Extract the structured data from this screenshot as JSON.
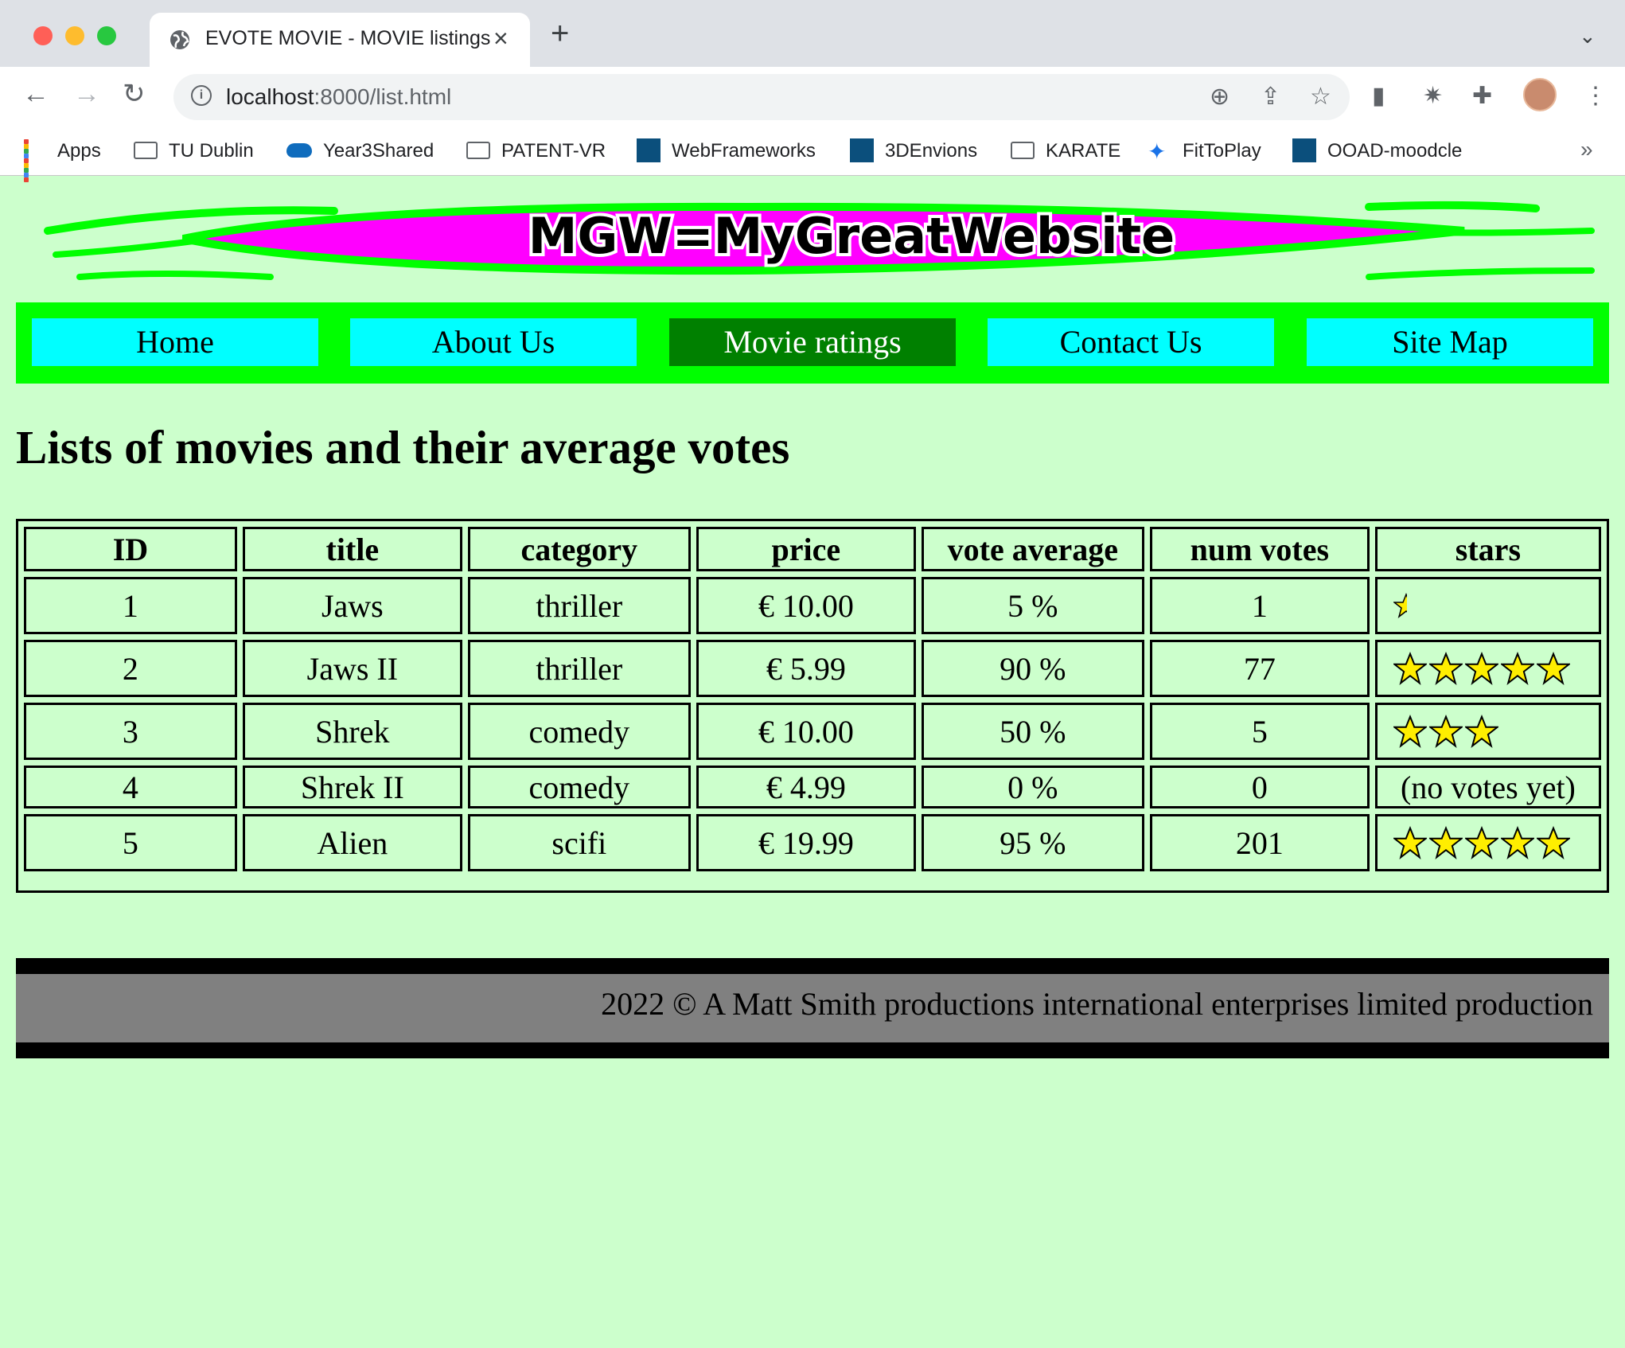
{
  "browser": {
    "tab_title": "EVOTE MOVIE - MOVIE listings",
    "url_host": "localhost",
    "url_rest": ":8000/list.html",
    "bookmarks": [
      {
        "label": "Apps",
        "icon": "apps-grid-icon"
      },
      {
        "label": "TU Dublin",
        "icon": "folder-icon"
      },
      {
        "label": "Year3Shared",
        "icon": "onedrive-cloud-icon"
      },
      {
        "label": "PATENT-VR",
        "icon": "folder-icon"
      },
      {
        "label": "WebFrameworks",
        "icon": "site-icon"
      },
      {
        "label": "3DEnvions",
        "icon": "site-icon"
      },
      {
        "label": "KARATE",
        "icon": "folder-icon"
      },
      {
        "label": "FitToPlay",
        "icon": "runner-icon"
      },
      {
        "label": "OOAD-moodcle",
        "icon": "site-icon"
      }
    ]
  },
  "banner": {
    "logo_text": "MGW=MyGreatWebsite"
  },
  "nav": [
    {
      "label": "Home",
      "active": false
    },
    {
      "label": "About Us",
      "active": false
    },
    {
      "label": "Movie ratings",
      "active": true
    },
    {
      "label": "Contact Us",
      "active": false
    },
    {
      "label": "Site Map",
      "active": false
    }
  ],
  "page": {
    "heading": "Lists of movies and their average votes"
  },
  "table": {
    "headers": [
      "ID",
      "title",
      "category",
      "price",
      "vote average",
      "num votes",
      "stars"
    ],
    "rows": [
      {
        "id": "1",
        "title": "Jaws",
        "category": "thriller",
        "price": "€ 10.00",
        "vote_average": "5 %",
        "num_votes": "1",
        "stars": 0.5,
        "stars_text": ""
      },
      {
        "id": "2",
        "title": "Jaws II",
        "category": "thriller",
        "price": "€ 5.99",
        "vote_average": "90 %",
        "num_votes": "77",
        "stars": 5,
        "stars_text": ""
      },
      {
        "id": "3",
        "title": "Shrek",
        "category": "comedy",
        "price": "€ 10.00",
        "vote_average": "50 %",
        "num_votes": "5",
        "stars": 3,
        "stars_text": ""
      },
      {
        "id": "4",
        "title": "Shrek II",
        "category": "comedy",
        "price": "€ 4.99",
        "vote_average": "0 %",
        "num_votes": "0",
        "stars": 0,
        "stars_text": "(no votes yet)"
      },
      {
        "id": "5",
        "title": "Alien",
        "category": "scifi",
        "price": "€ 19.99",
        "vote_average": "95 %",
        "num_votes": "201",
        "stars": 5,
        "stars_text": ""
      }
    ]
  },
  "footer": {
    "text": "2022 © A Matt Smith productions international enterprises limited production"
  },
  "colors": {
    "page_bg": "#ccffcc",
    "nav_bg": "#00ff00",
    "nav_item": "#00ffff",
    "nav_active": "#008000",
    "footer_bg": "#808080",
    "star": "#ffee00"
  }
}
